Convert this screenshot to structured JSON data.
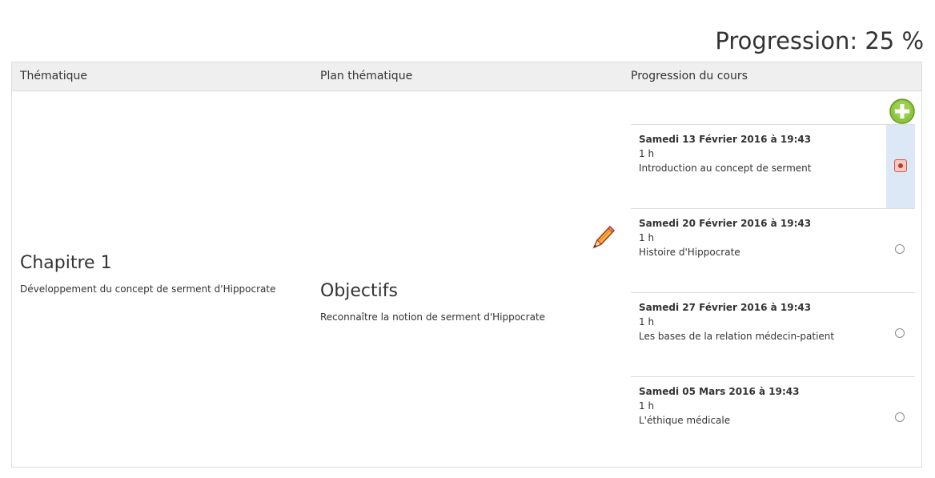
{
  "progress": {
    "label": "Progression: 25 %",
    "percent": 25
  },
  "table": {
    "headers": {
      "theme": "Thématique",
      "plan": "Plan thématique",
      "course_progress": "Progression du cours"
    },
    "chapter": {
      "title": "Chapitre 1",
      "description": "Développement du concept de serment d'Hippocrate"
    },
    "objectives": {
      "title": "Objectifs",
      "description": "Reconnaître la notion de serment d'Hippocrate"
    },
    "entries": [
      {
        "date": "Samedi 13 Février 2016 à 19:43",
        "duration": "1 h",
        "description": "Introduction au concept de serment",
        "selected": true
      },
      {
        "date": "Samedi 20 Février 2016 à 19:43",
        "duration": "1 h",
        "description": "Histoire d'Hippocrate",
        "selected": false
      },
      {
        "date": "Samedi 27 Février 2016 à 19:43",
        "duration": "1 h",
        "description": "Les bases de la relation médecin-patient",
        "selected": false
      },
      {
        "date": "Samedi 05 Mars 2016 à 19:43",
        "duration": "1 h",
        "description": "L'éthique médicale",
        "selected": false
      }
    ]
  },
  "icons": {
    "add": "add-icon",
    "edit": "pencil-icon",
    "accent_green": "#8cc63e",
    "selected_bg": "#dde8f7",
    "header_bg": "#efefef"
  }
}
